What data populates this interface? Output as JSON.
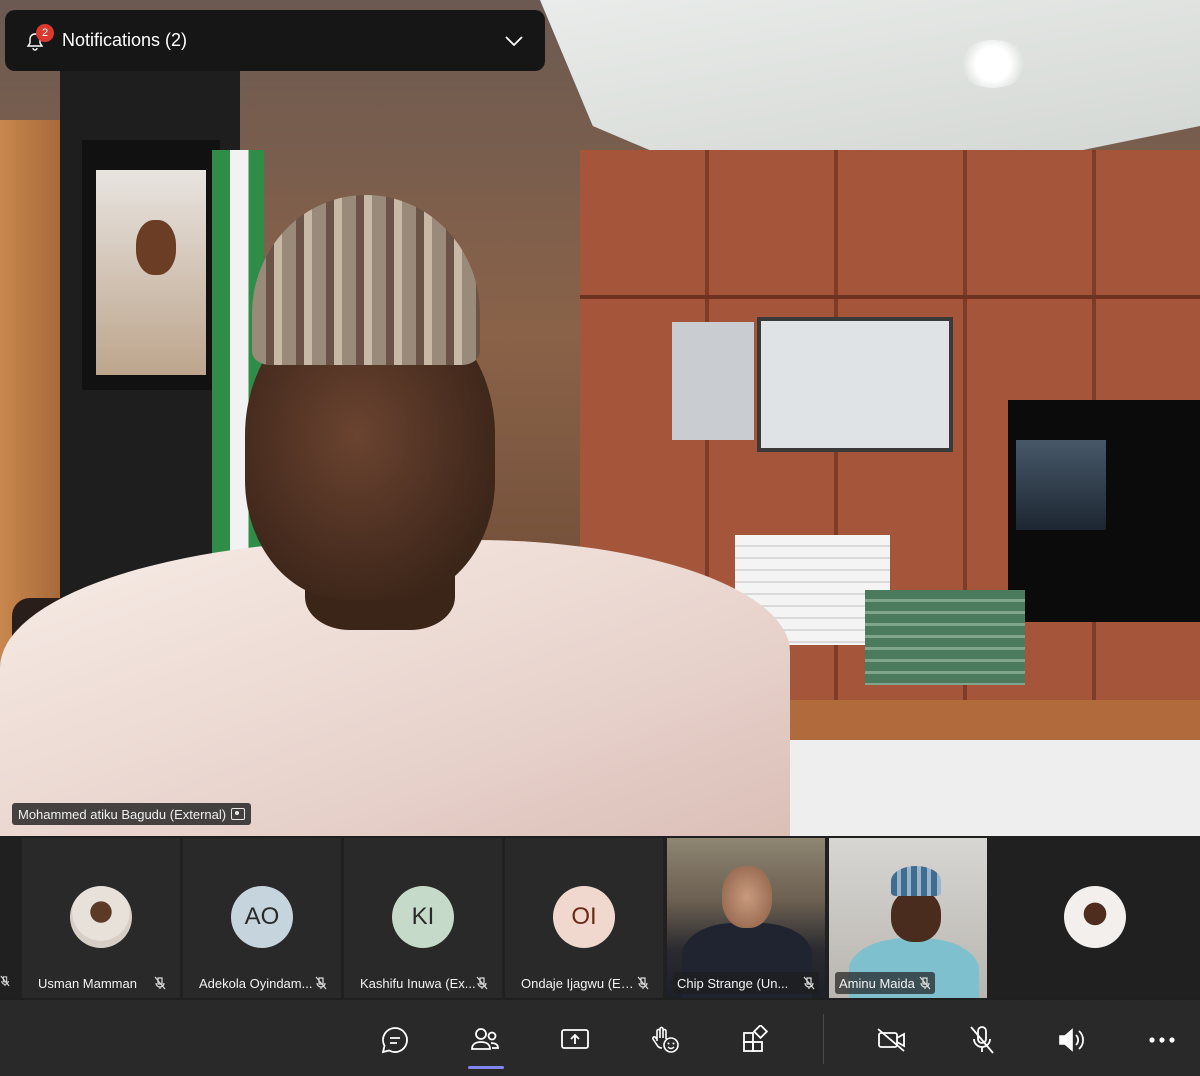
{
  "notifications": {
    "title": "Notifications (2)",
    "badge": "2"
  },
  "main_speaker": {
    "name": "Mohammed atiku Bagudu (External)"
  },
  "participants": [
    {
      "name": "Usman Mamman",
      "initials": "",
      "avatar_color": ""
    },
    {
      "name": "Adekola Oyindam...",
      "initials": "AO",
      "avatar_color": "#c6d4dd"
    },
    {
      "name": "Kashifu Inuwa (Ex...",
      "initials": "KI",
      "avatar_color": "#c5dac9"
    },
    {
      "name": "Ondaje Ijagwu (Ex...",
      "initials": "OI",
      "avatar_color": "#f1d8cf"
    },
    {
      "name": "Chip Strange (Un...",
      "initials": "",
      "avatar_color": ""
    },
    {
      "name": "Aminu Maida",
      "initials": "",
      "avatar_color": ""
    }
  ],
  "toolbar": {
    "buttons": [
      "chat-icon",
      "people-icon",
      "share-screen-icon",
      "react-icon",
      "apps-icon",
      "camera-off-icon",
      "mic-off-icon",
      "speaker-icon",
      "more-icon"
    ],
    "active": "people-icon",
    "accent": "#7f85f5"
  },
  "colors": {
    "badge": "#d93a2d",
    "background": "#1f1f1f"
  }
}
